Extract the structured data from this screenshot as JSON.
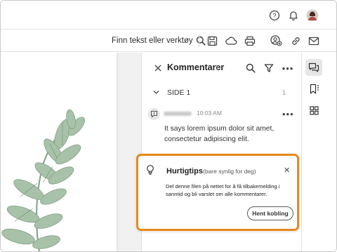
{
  "topbar": {
    "icons": [
      "help-icon",
      "notification-bell-icon",
      "user-avatar"
    ]
  },
  "toolbar": {
    "find_label": "Finn tekst eller verktøy",
    "icons": [
      "search-icon",
      "save-icon",
      "cloud-upload-icon",
      "print-icon",
      "share-user-icon",
      "link-icon",
      "email-icon"
    ]
  },
  "comments_panel": {
    "title": "Kommentarer",
    "count": "1",
    "section": {
      "label": "SIDE 1",
      "count": "1"
    },
    "comment": {
      "time": "10:03 AM",
      "text": "It says lorem ipsum dolor sit amet, consectetur adipiscing elit."
    }
  },
  "quick_tip": {
    "title": "Hurtigtips",
    "subtitle": "(bare synlig for deg)",
    "body": "Del denne filen på nettet for å få tilbakemelding i sanntid og bli varslet om alle kommentarer.",
    "button": "Hent kobling",
    "highlight_color": "#e8891a"
  },
  "right_rail": {
    "icons": [
      "comments-icon",
      "bookmark-icon",
      "thumbnails-icon"
    ]
  },
  "colors": {
    "leaf_green": "#8fae92",
    "border": "#e1e1e1"
  }
}
